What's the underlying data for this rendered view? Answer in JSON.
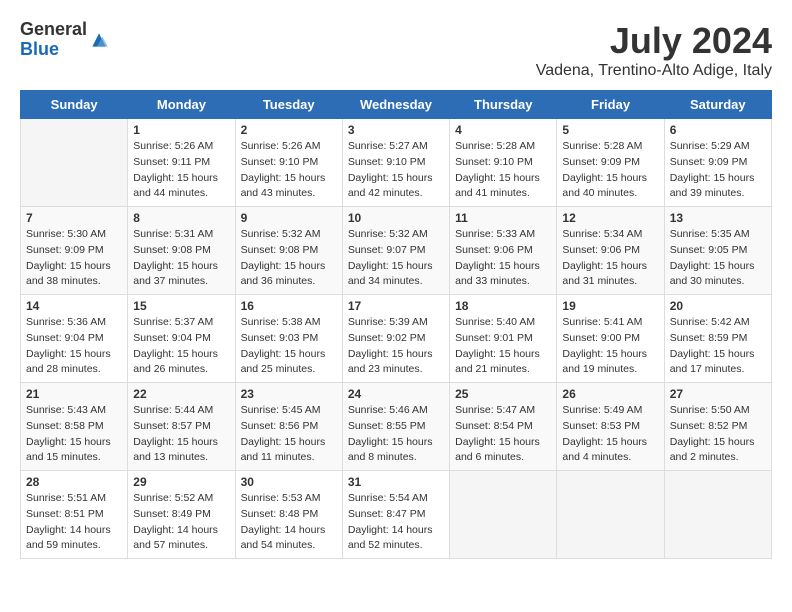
{
  "header": {
    "logo": {
      "general": "General",
      "blue": "Blue"
    },
    "title": "July 2024",
    "location": "Vadena, Trentino-Alto Adige, Italy"
  },
  "weekdays": [
    "Sunday",
    "Monday",
    "Tuesday",
    "Wednesday",
    "Thursday",
    "Friday",
    "Saturday"
  ],
  "weeks": [
    [
      {
        "day": "",
        "info": ""
      },
      {
        "day": "1",
        "info": "Sunrise: 5:26 AM\nSunset: 9:11 PM\nDaylight: 15 hours\nand 44 minutes."
      },
      {
        "day": "2",
        "info": "Sunrise: 5:26 AM\nSunset: 9:10 PM\nDaylight: 15 hours\nand 43 minutes."
      },
      {
        "day": "3",
        "info": "Sunrise: 5:27 AM\nSunset: 9:10 PM\nDaylight: 15 hours\nand 42 minutes."
      },
      {
        "day": "4",
        "info": "Sunrise: 5:28 AM\nSunset: 9:10 PM\nDaylight: 15 hours\nand 41 minutes."
      },
      {
        "day": "5",
        "info": "Sunrise: 5:28 AM\nSunset: 9:09 PM\nDaylight: 15 hours\nand 40 minutes."
      },
      {
        "day": "6",
        "info": "Sunrise: 5:29 AM\nSunset: 9:09 PM\nDaylight: 15 hours\nand 39 minutes."
      }
    ],
    [
      {
        "day": "7",
        "info": "Sunrise: 5:30 AM\nSunset: 9:09 PM\nDaylight: 15 hours\nand 38 minutes."
      },
      {
        "day": "8",
        "info": "Sunrise: 5:31 AM\nSunset: 9:08 PM\nDaylight: 15 hours\nand 37 minutes."
      },
      {
        "day": "9",
        "info": "Sunrise: 5:32 AM\nSunset: 9:08 PM\nDaylight: 15 hours\nand 36 minutes."
      },
      {
        "day": "10",
        "info": "Sunrise: 5:32 AM\nSunset: 9:07 PM\nDaylight: 15 hours\nand 34 minutes."
      },
      {
        "day": "11",
        "info": "Sunrise: 5:33 AM\nSunset: 9:06 PM\nDaylight: 15 hours\nand 33 minutes."
      },
      {
        "day": "12",
        "info": "Sunrise: 5:34 AM\nSunset: 9:06 PM\nDaylight: 15 hours\nand 31 minutes."
      },
      {
        "day": "13",
        "info": "Sunrise: 5:35 AM\nSunset: 9:05 PM\nDaylight: 15 hours\nand 30 minutes."
      }
    ],
    [
      {
        "day": "14",
        "info": "Sunrise: 5:36 AM\nSunset: 9:04 PM\nDaylight: 15 hours\nand 28 minutes."
      },
      {
        "day": "15",
        "info": "Sunrise: 5:37 AM\nSunset: 9:04 PM\nDaylight: 15 hours\nand 26 minutes."
      },
      {
        "day": "16",
        "info": "Sunrise: 5:38 AM\nSunset: 9:03 PM\nDaylight: 15 hours\nand 25 minutes."
      },
      {
        "day": "17",
        "info": "Sunrise: 5:39 AM\nSunset: 9:02 PM\nDaylight: 15 hours\nand 23 minutes."
      },
      {
        "day": "18",
        "info": "Sunrise: 5:40 AM\nSunset: 9:01 PM\nDaylight: 15 hours\nand 21 minutes."
      },
      {
        "day": "19",
        "info": "Sunrise: 5:41 AM\nSunset: 9:00 PM\nDaylight: 15 hours\nand 19 minutes."
      },
      {
        "day": "20",
        "info": "Sunrise: 5:42 AM\nSunset: 8:59 PM\nDaylight: 15 hours\nand 17 minutes."
      }
    ],
    [
      {
        "day": "21",
        "info": "Sunrise: 5:43 AM\nSunset: 8:58 PM\nDaylight: 15 hours\nand 15 minutes."
      },
      {
        "day": "22",
        "info": "Sunrise: 5:44 AM\nSunset: 8:57 PM\nDaylight: 15 hours\nand 13 minutes."
      },
      {
        "day": "23",
        "info": "Sunrise: 5:45 AM\nSunset: 8:56 PM\nDaylight: 15 hours\nand 11 minutes."
      },
      {
        "day": "24",
        "info": "Sunrise: 5:46 AM\nSunset: 8:55 PM\nDaylight: 15 hours\nand 8 minutes."
      },
      {
        "day": "25",
        "info": "Sunrise: 5:47 AM\nSunset: 8:54 PM\nDaylight: 15 hours\nand 6 minutes."
      },
      {
        "day": "26",
        "info": "Sunrise: 5:49 AM\nSunset: 8:53 PM\nDaylight: 15 hours\nand 4 minutes."
      },
      {
        "day": "27",
        "info": "Sunrise: 5:50 AM\nSunset: 8:52 PM\nDaylight: 15 hours\nand 2 minutes."
      }
    ],
    [
      {
        "day": "28",
        "info": "Sunrise: 5:51 AM\nSunset: 8:51 PM\nDaylight: 14 hours\nand 59 minutes."
      },
      {
        "day": "29",
        "info": "Sunrise: 5:52 AM\nSunset: 8:49 PM\nDaylight: 14 hours\nand 57 minutes."
      },
      {
        "day": "30",
        "info": "Sunrise: 5:53 AM\nSunset: 8:48 PM\nDaylight: 14 hours\nand 54 minutes."
      },
      {
        "day": "31",
        "info": "Sunrise: 5:54 AM\nSunset: 8:47 PM\nDaylight: 14 hours\nand 52 minutes."
      },
      {
        "day": "",
        "info": ""
      },
      {
        "day": "",
        "info": ""
      },
      {
        "day": "",
        "info": ""
      }
    ]
  ]
}
